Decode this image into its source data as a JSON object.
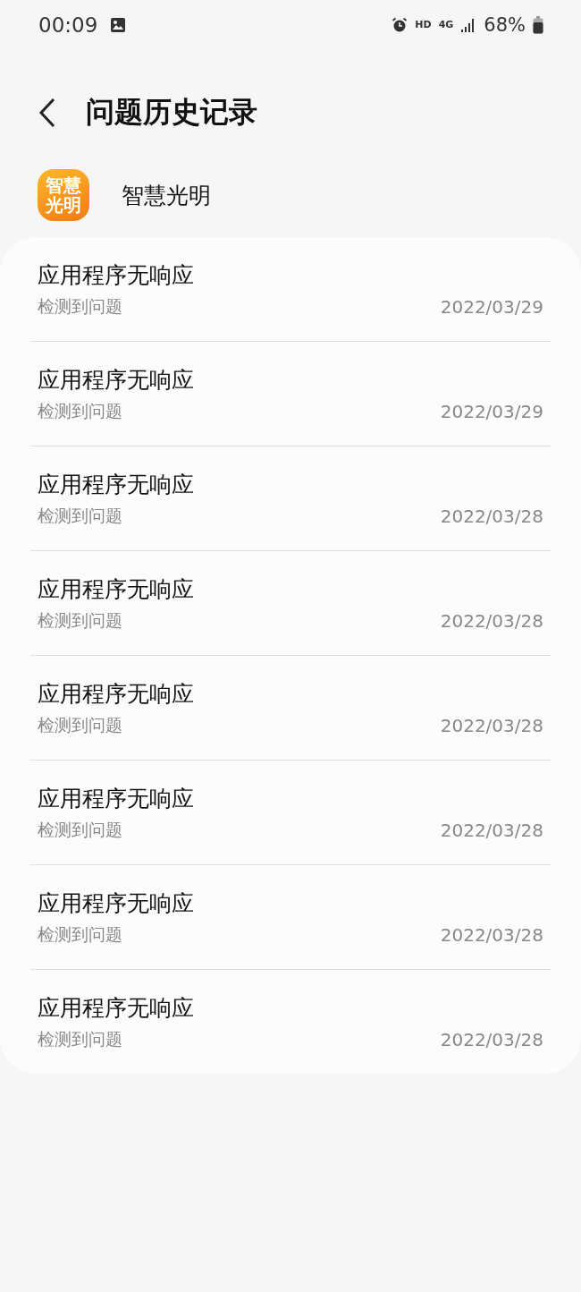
{
  "status_bar": {
    "time": "00:09",
    "hd": "HD",
    "network": "4G",
    "battery": "68%"
  },
  "header": {
    "title": "问题历史记录"
  },
  "app": {
    "icon_text": [
      "智慧",
      "光明"
    ],
    "name": "智慧光明"
  },
  "reports": [
    {
      "title": "应用程序无响应",
      "subtitle": "检测到问题",
      "date": "2022/03/29"
    },
    {
      "title": "应用程序无响应",
      "subtitle": "检测到问题",
      "date": "2022/03/29"
    },
    {
      "title": "应用程序无响应",
      "subtitle": "检测到问题",
      "date": "2022/03/28"
    },
    {
      "title": "应用程序无响应",
      "subtitle": "检测到问题",
      "date": "2022/03/28"
    },
    {
      "title": "应用程序无响应",
      "subtitle": "检测到问题",
      "date": "2022/03/28"
    },
    {
      "title": "应用程序无响应",
      "subtitle": "检测到问题",
      "date": "2022/03/28"
    },
    {
      "title": "应用程序无响应",
      "subtitle": "检测到问题",
      "date": "2022/03/28"
    },
    {
      "title": "应用程序无响应",
      "subtitle": "检测到问题",
      "date": "2022/03/28"
    }
  ]
}
